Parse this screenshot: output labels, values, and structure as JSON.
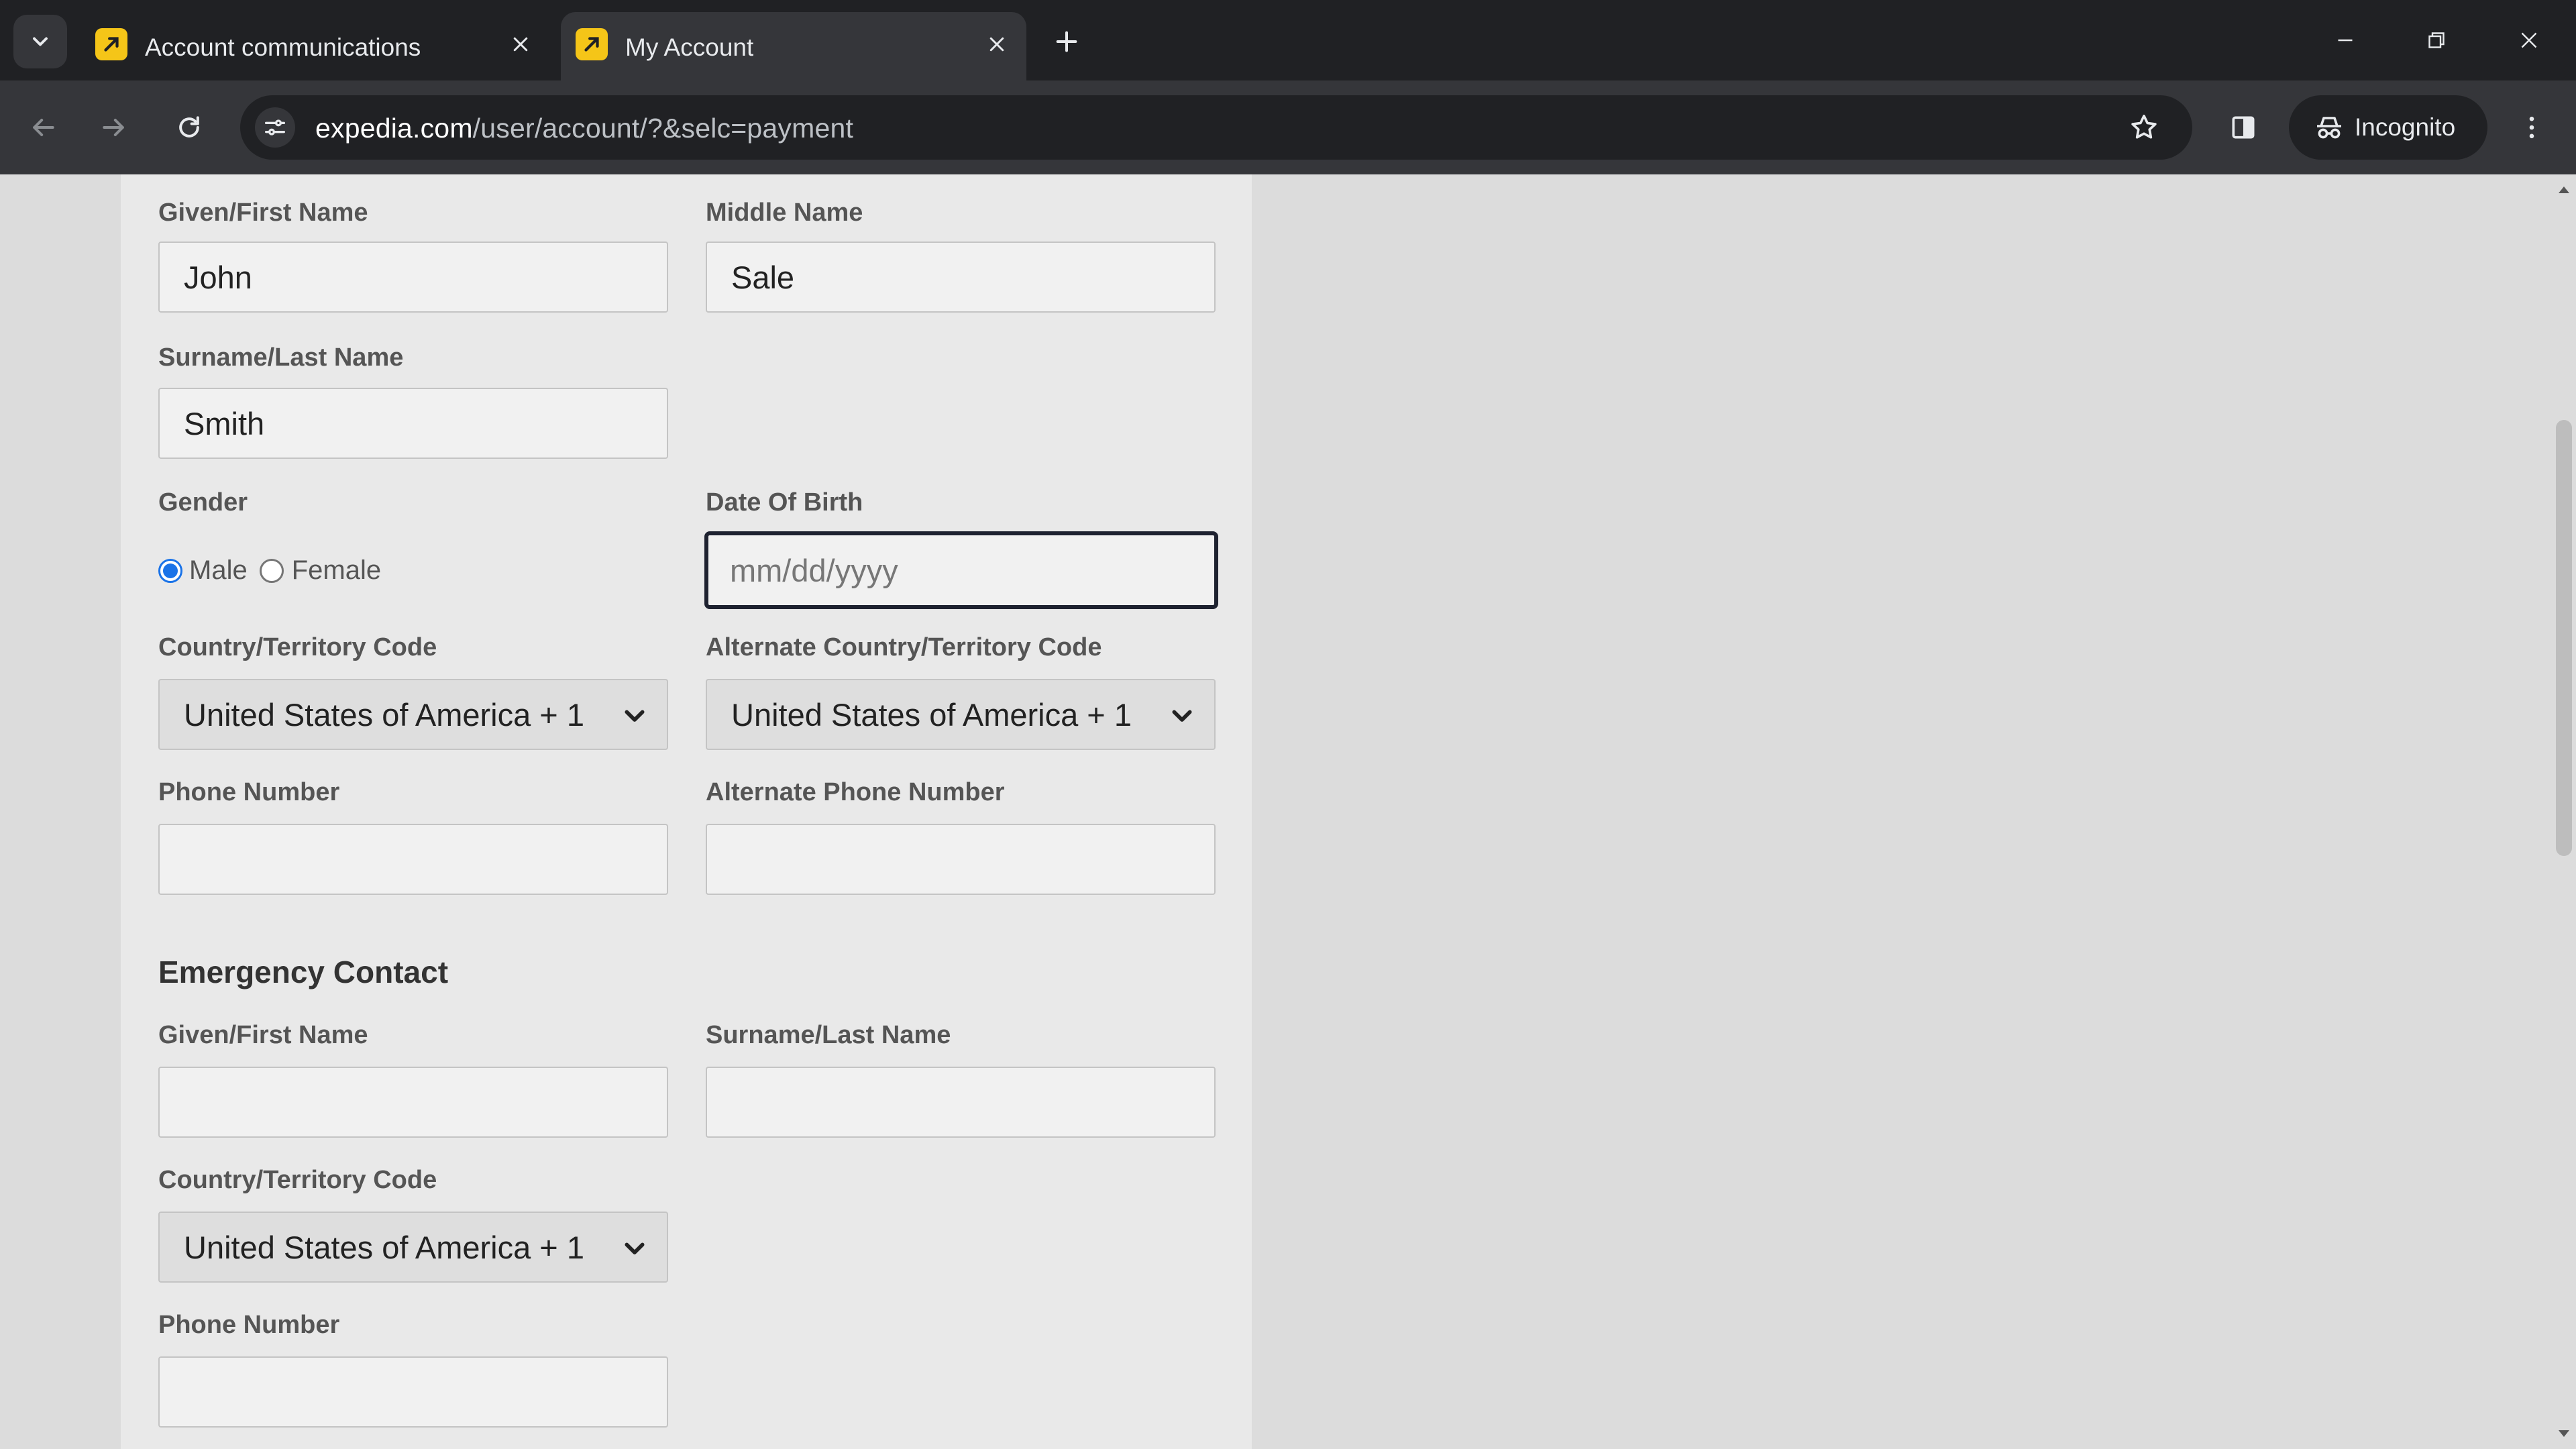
{
  "browser": {
    "tabs": [
      {
        "title": "Account communications",
        "active": false
      },
      {
        "title": "My Account",
        "active": true
      }
    ],
    "url_domain": "expedia.com",
    "url_path": "/user/account/?&selc=payment",
    "profile_label": "Incognito"
  },
  "form": {
    "first_name_label": "Given/First Name",
    "first_name_value": "John",
    "middle_name_label": "Middle Name",
    "middle_name_value": "Sale",
    "last_name_label": "Surname/Last Name",
    "last_name_value": "Smith",
    "gender_label": "Gender",
    "gender_options": [
      "Male",
      "Female"
    ],
    "gender_selected": "Male",
    "dob_label": "Date Of Birth",
    "dob_placeholder": "mm/dd/yyyy",
    "country_code_label": "Country/Territory Code",
    "country_code_value": "United States of America + 1",
    "alt_country_code_label": "Alternate Country/Territory Code",
    "alt_country_code_value": "United States of America + 1",
    "phone_label": "Phone Number",
    "phone_value": "",
    "alt_phone_label": "Alternate Phone Number",
    "alt_phone_value": ""
  },
  "emergency": {
    "title": "Emergency Contact",
    "first_name_label": "Given/First Name",
    "first_name_value": "",
    "last_name_label": "Surname/Last Name",
    "last_name_value": "",
    "country_code_label": "Country/Territory Code",
    "country_code_value": "United States of America + 1",
    "phone_label": "Phone Number",
    "phone_value": ""
  },
  "colors": {
    "accent": "#1a73e8",
    "tab_bar": "#202124",
    "toolbar": "#35363a",
    "favicon": "#f5c518"
  }
}
